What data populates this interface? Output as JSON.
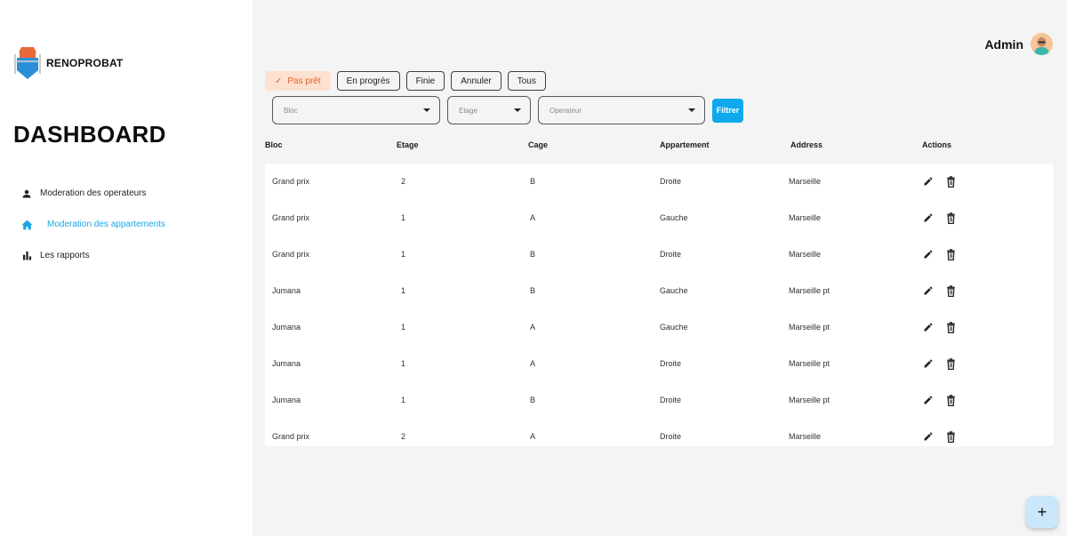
{
  "brand": {
    "name": "RENOPROBAT",
    "logo_icon": "renoprobat-logo"
  },
  "page_title": "DASHBOARD",
  "sidebar": {
    "items": [
      {
        "label": "Moderation des operateurs",
        "icon": "person-icon",
        "active": false
      },
      {
        "label": "Moderation des appartements",
        "icon": "home-icon",
        "active": true
      },
      {
        "label": "Les rapports",
        "icon": "bar-chart-icon",
        "active": false
      }
    ]
  },
  "user": {
    "name": "Admin",
    "avatar": "user-avatar"
  },
  "status_filters": [
    {
      "label": "Pas prêt",
      "selected": true
    },
    {
      "label": "En progrès",
      "selected": false
    },
    {
      "label": "Finie",
      "selected": false
    },
    {
      "label": "Annuler",
      "selected": false
    },
    {
      "label": "Tous",
      "selected": false
    }
  ],
  "filters": {
    "bloc_placeholder": "Bloc",
    "etage_placeholder": "Etage",
    "operateur_placeholder": "Operateur",
    "filter_button": "Filtrer"
  },
  "table": {
    "headers": [
      "Bloc",
      "Etage",
      "Cage",
      "Appartement",
      "Address",
      "Actions"
    ],
    "rows": [
      [
        "Grand prix",
        "2",
        "B",
        "Droite",
        "Marseille"
      ],
      [
        "Grand prix",
        "1",
        "A",
        "Gauche",
        "Marseille"
      ],
      [
        "Grand prix",
        "1",
        "B",
        "Droite",
        "Marseille"
      ],
      [
        "Jumana",
        "1",
        "B",
        "Gauche",
        "Marseille pt"
      ],
      [
        "Jumana",
        "1",
        "A",
        "Gauche",
        "Marseille pt"
      ],
      [
        "Jumana",
        "1",
        "A",
        "Droite",
        "Marseille pt"
      ],
      [
        "Jumana",
        "1",
        "B",
        "Droite",
        "Marseille pt"
      ],
      [
        "Grand prix",
        "2",
        "A",
        "Droite",
        "Marseille"
      ]
    ]
  },
  "fab": {
    "label": "+",
    "icon": "add-icon"
  },
  "colors": {
    "accent": "#10a8ec",
    "active_nav": "#1ba6e4",
    "chip_selected_bg": "#fde1cf",
    "chip_selected_text": "#e0612a"
  }
}
